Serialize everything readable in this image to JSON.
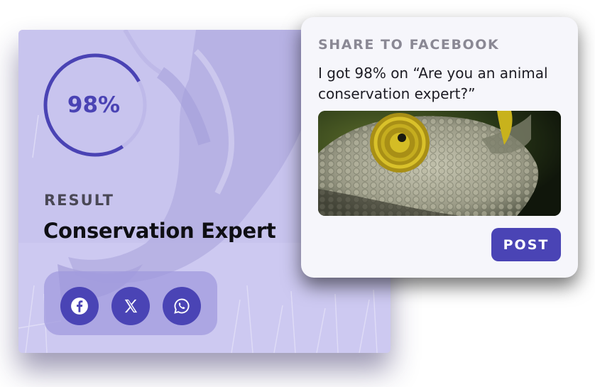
{
  "result_card": {
    "score_text": "98%",
    "score_fraction": 0.98,
    "label": "RESULT",
    "title": "Conservation Expert",
    "background_icon": "rhino-photo",
    "share_buttons": [
      {
        "name": "facebook",
        "icon": "facebook-icon"
      },
      {
        "name": "x",
        "icon": "x-icon"
      },
      {
        "name": "whatsapp",
        "icon": "whatsapp-icon"
      }
    ]
  },
  "share_panel": {
    "heading": "SHARE TO FACEBOOK",
    "message": "I got 98% on “Are you an animal conservation expert?”",
    "image_icon": "chameleon-photo",
    "post_label": "POST"
  },
  "colors": {
    "accent": "#4a44b5",
    "card_tint": "#c6c2ec",
    "panel_bg": "#f6f6fb"
  }
}
